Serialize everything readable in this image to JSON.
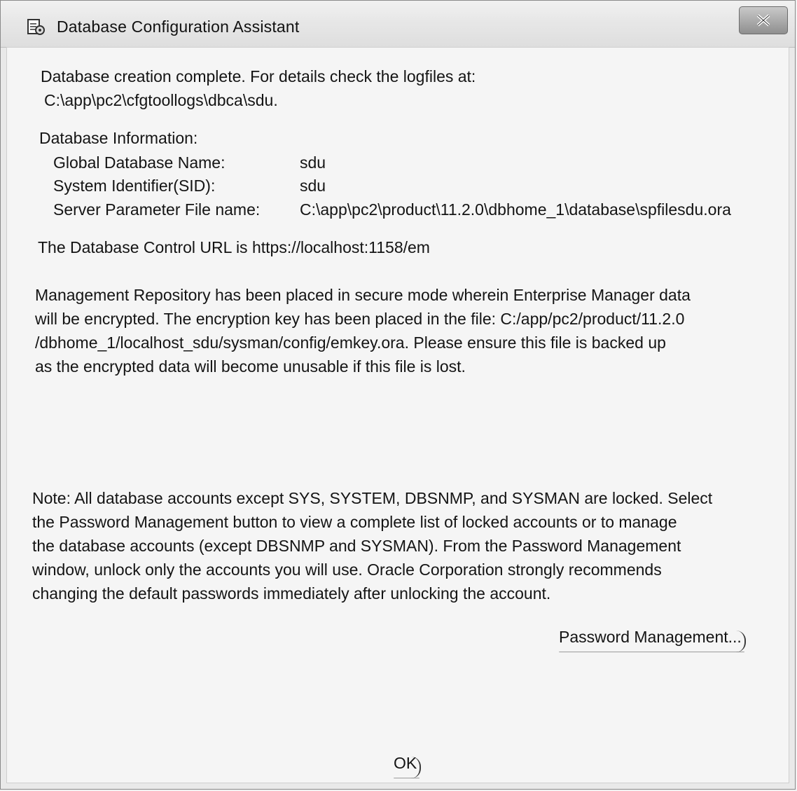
{
  "window": {
    "title": "Database Configuration Assistant"
  },
  "dialog": {
    "completion_line1": "Database creation complete. For details check the logfiles at:",
    "completion_line2": "C:\\app\\pc2\\cfgtoollogs\\dbca\\sdu.",
    "info_heading": "Database Information:",
    "info": [
      {
        "label": "Global Database Name:",
        "value": "sdu"
      },
      {
        "label": "System Identifier(SID):",
        "value": "sdu"
      },
      {
        "label": "Server Parameter File name:",
        "value": "C:\\app\\pc2\\product\\11.2.0\\dbhome_1\\database\\spfilesdu.ora"
      }
    ],
    "control_url_line": "The Database Control URL is https://localhost:1158/em",
    "repository_lines": [
      "Management Repository has been placed in secure mode wherein Enterprise Manager data",
      "will be encrypted.  The encryption key has been placed in the file: C:/app/pc2/product/11.2.0",
      "/dbhome_1/localhost_sdu/sysman/config/emkey.ora.   Please ensure this file is backed up",
      "as the encrypted data will become unusable if this file is lost."
    ],
    "note_lines": [
      "Note: All database accounts except SYS, SYSTEM, DBSNMP, and SYSMAN are locked. Select",
      "the Password Management button to view a complete list of locked accounts or to manage",
      "the database accounts (except DBSNMP and SYSMAN). From the Password Management",
      "window, unlock only the accounts you will use. Oracle Corporation strongly recommends",
      "changing the default passwords immediately after unlocking the account."
    ],
    "password_button": "Password Management...",
    "ok_button": "OK"
  }
}
